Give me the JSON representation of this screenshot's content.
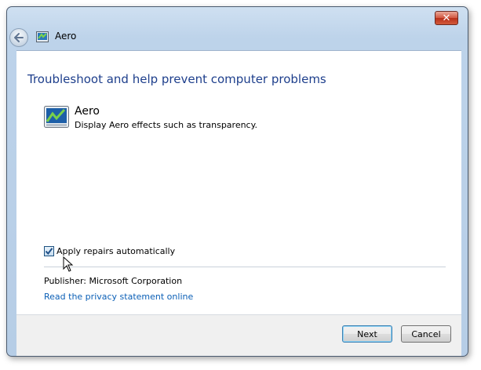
{
  "window": {
    "title": "Aero",
    "close_label": "✕"
  },
  "main": {
    "heading": "Troubleshoot and help prevent computer problems",
    "item": {
      "name": "Aero",
      "description": "Display Aero effects such as transparency."
    },
    "apply_checkbox": {
      "label": "Apply repairs automatically",
      "checked": true
    },
    "publisher": "Publisher:  Microsoft Corporation",
    "privacy_link": "Read the privacy statement online"
  },
  "footer": {
    "next_label": "Next",
    "cancel_label": "Cancel"
  },
  "icons": {
    "back": "back-arrow-icon",
    "title": "aero-window-icon",
    "item": "aero-troubleshooter-icon",
    "check": "checkmark-icon",
    "cursor": "mouse-pointer-icon"
  }
}
